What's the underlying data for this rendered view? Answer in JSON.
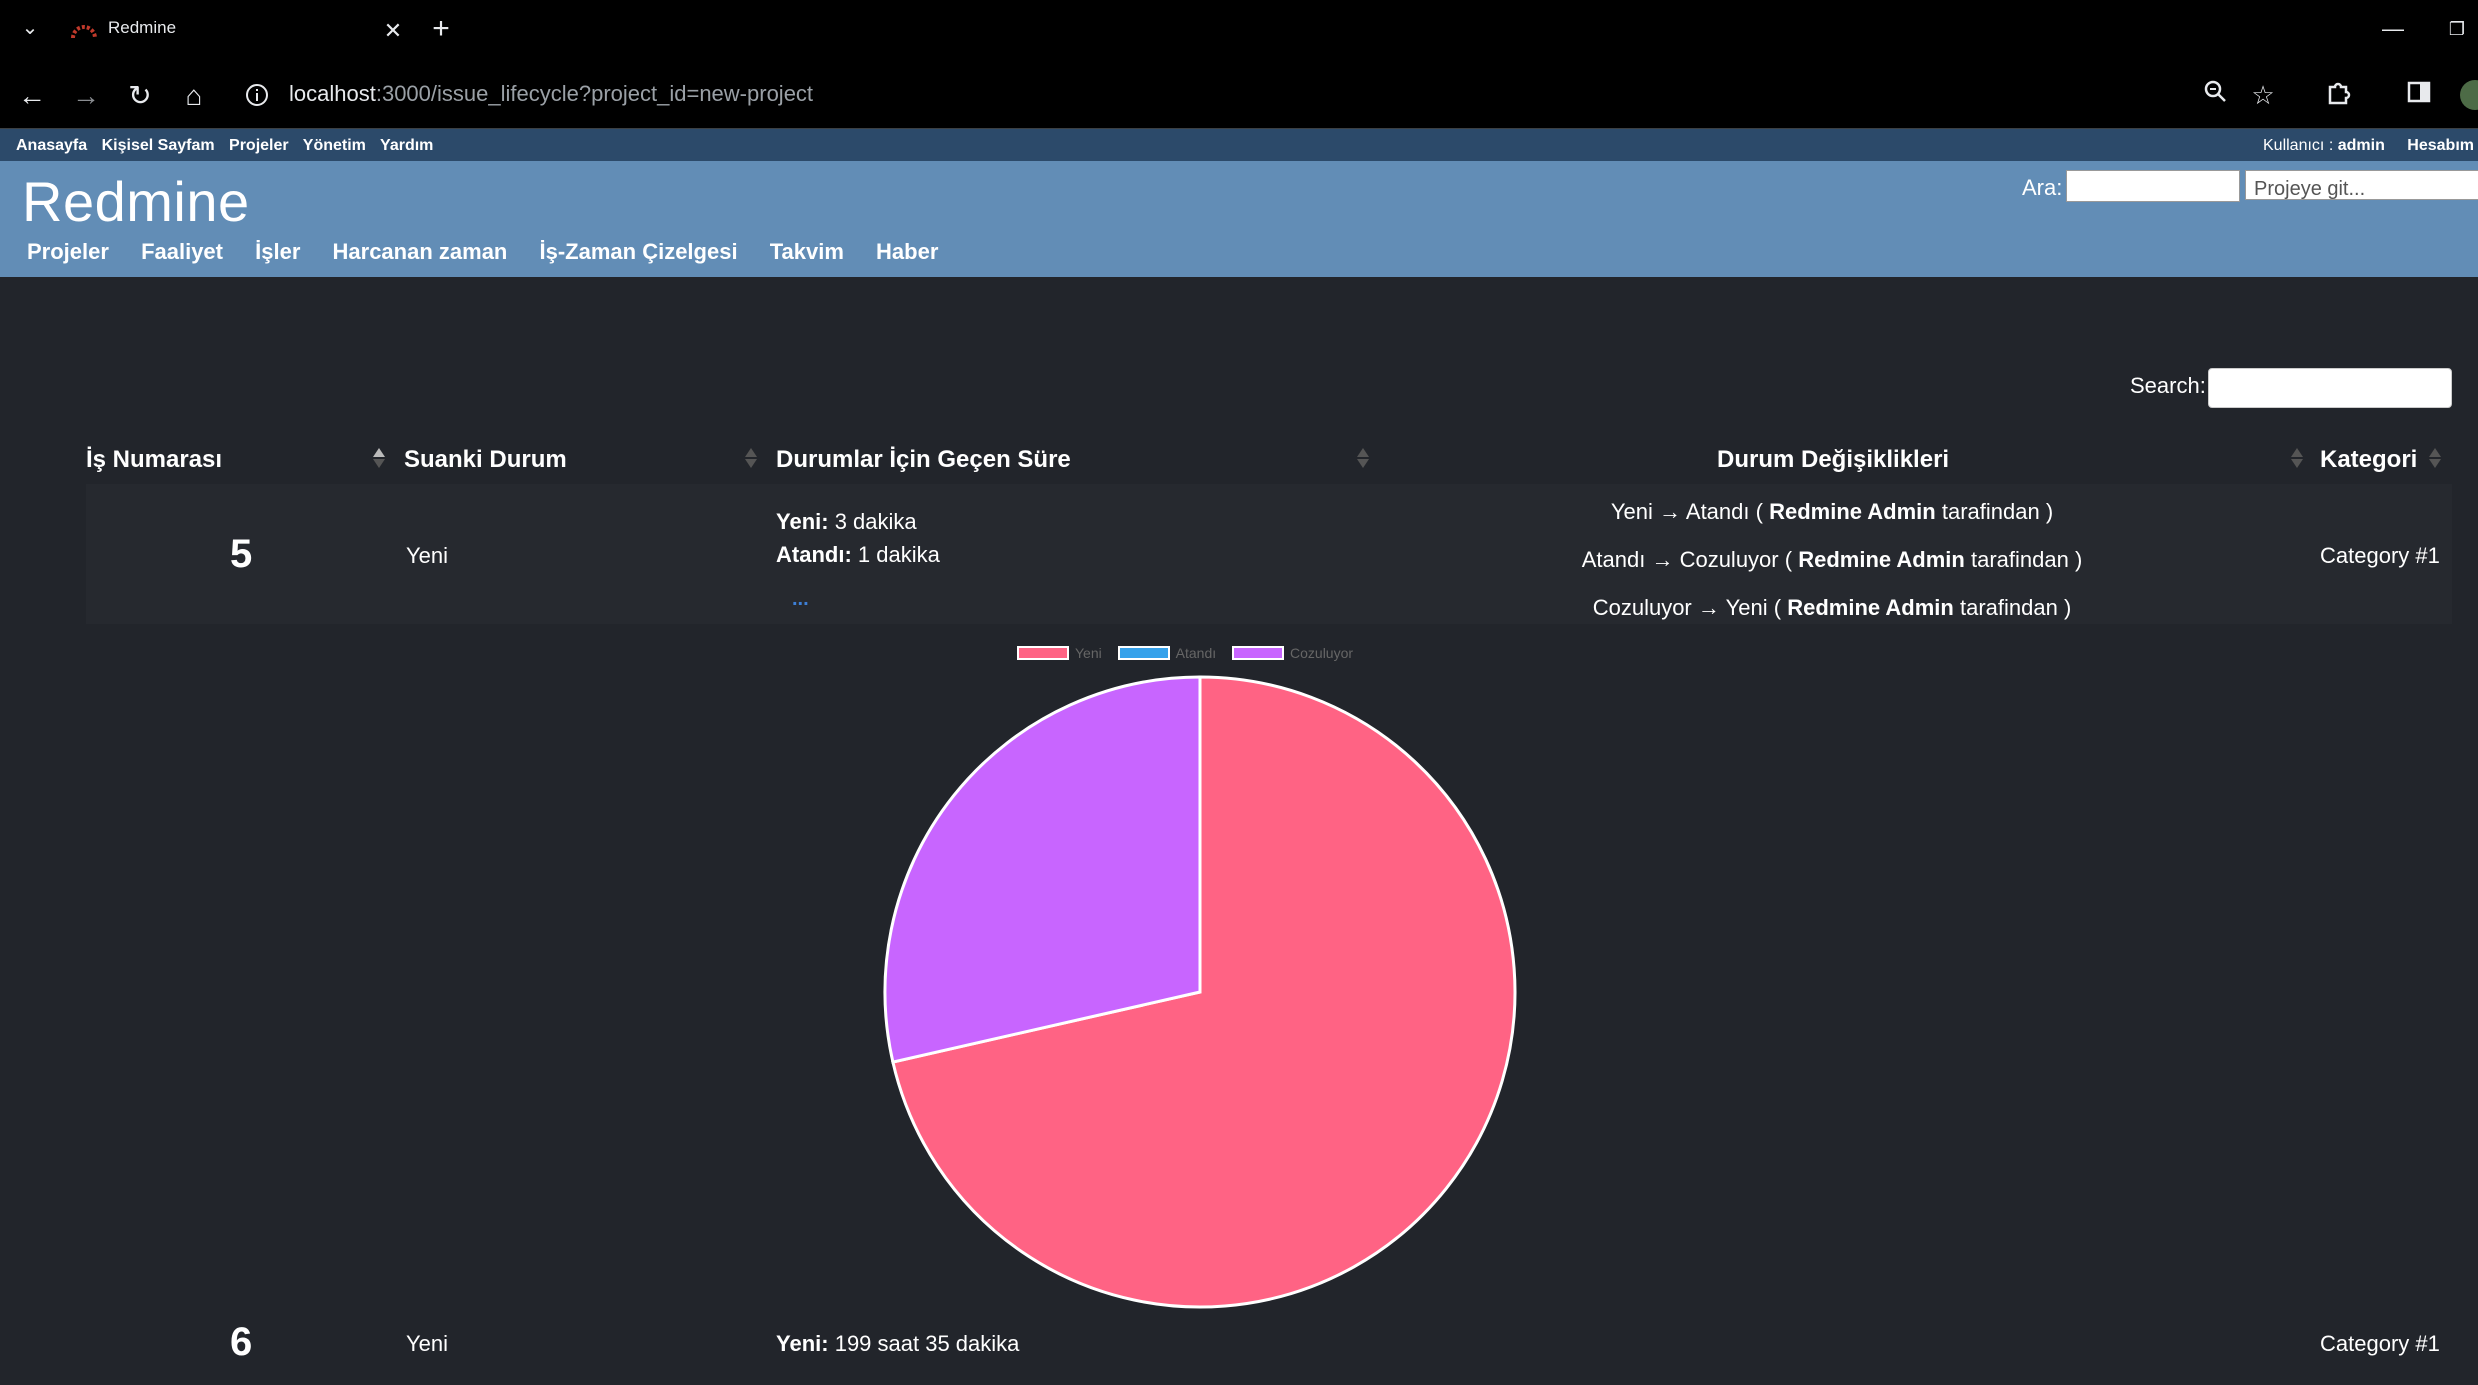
{
  "browser": {
    "tab_title": "Redmine",
    "url_host": "localhost",
    "url_rest": ":3000/issue_lifecycle?project_id=new-project"
  },
  "topmenu": {
    "items": [
      "Anasayfa",
      "Kişisel Sayfam",
      "Projeler",
      "Yönetim",
      "Yardım"
    ],
    "user_label": "Kullanıcı :",
    "user_name": "admin",
    "account": "Hesabım"
  },
  "header": {
    "title": "Redmine",
    "search_label": "Ara:",
    "jump_placeholder": "Projeye git...",
    "menu": [
      "Projeler",
      "Faaliyet",
      "İşler",
      "Harcanan zaman",
      "İş-Zaman Çizelgesi",
      "Takvim",
      "Haber"
    ]
  },
  "table": {
    "search_label": "Search:",
    "columns": [
      "İş Numarası",
      "Suanki Durum",
      "Durumlar İçin Geçen Süre",
      "Durum Değişiklikleri",
      "Kategori"
    ],
    "rows": [
      {
        "id": "5",
        "status": "Yeni",
        "durations": [
          {
            "label": "Yeni:",
            "value": "3 dakika"
          },
          {
            "label": "Atandı:",
            "value": "1 dakika"
          }
        ],
        "more": "...",
        "changes": [
          {
            "from": "Yeni",
            "arrow": "→",
            "to": "Atandı",
            "open": "(",
            "user": "Redmine Admin",
            "by": "tarafindan )"
          },
          {
            "from": "Atandı",
            "arrow": "→",
            "to": "Cozuluyor",
            "open": "(",
            "user": "Redmine Admin",
            "by": "tarafindan )"
          },
          {
            "from": "Cozuluyor",
            "arrow": "→",
            "to": "Yeni",
            "open": "(",
            "user": "Redmine Admin",
            "by": "tarafindan )"
          }
        ],
        "category": "Category #1"
      },
      {
        "id": "6",
        "status": "Yeni",
        "durations": [
          {
            "label": "Yeni:",
            "value": "199 saat 35 dakika"
          }
        ],
        "category": "Category #1"
      }
    ]
  },
  "chart_data": {
    "type": "pie",
    "categories": [
      "Yeni",
      "Atandı",
      "Cozuluyor"
    ],
    "values": [
      3,
      0,
      1.2
    ],
    "colors": [
      "#ff6384",
      "#36a2eb",
      "#c865ff"
    ],
    "legend": "top"
  },
  "icons": {
    "tab_list": "chevron-down-icon",
    "back": "arrow-left-icon",
    "forward": "arrow-right-icon",
    "reload": "reload-icon",
    "home": "home-icon",
    "site_info": "info-icon",
    "zoom": "zoom-icon",
    "bookmark": "star-icon",
    "extensions": "puzzle-icon",
    "side_panel": "side-panel-icon"
  }
}
